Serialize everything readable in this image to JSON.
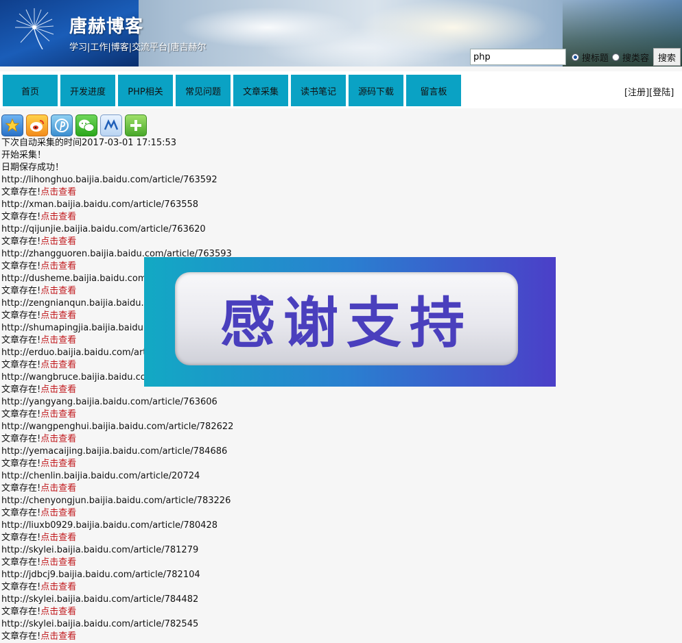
{
  "header": {
    "title": "唐赫博客",
    "subtitle": "学习|工作|博客|交流平台|唐吉赫尔",
    "search_value": "php",
    "radio_title_label": "搜标题",
    "radio_content_label": "搜类容",
    "search_button": "搜索"
  },
  "nav": {
    "items": [
      "首页",
      "开发进度",
      "PHP相关",
      "常见问题",
      "文章采集",
      "读书笔记",
      "源码下载",
      "留言板"
    ],
    "auth": "[注册][登陆]"
  },
  "share_icons": [
    "favorite-star-icon",
    "weibo-icon",
    "pinterest-icon",
    "wechat-icon",
    "renren-icon",
    "plus-icon"
  ],
  "log": {
    "next_time": "下次自动采集的时间2017-03-01 17:15:53",
    "start": "开始采集！",
    "date_saved": "日期保存成功！",
    "exists_prefix": "文章存在!",
    "view_link": "点击查看",
    "urls": [
      "http://lihonghuo.baijia.baidu.com/article/763592",
      "http://xman.baijia.baidu.com/article/763558",
      "http://qijunjie.baijia.baidu.com/article/763620",
      "http://zhangguoren.baijia.baidu.com/article/763593",
      "http://dusheme.baijia.baidu.com/",
      "http://zengnianqun.baijia.baidu.co",
      "http://shumapingjia.baijia.baidu.c",
      "http://erduo.baijia.baidu.com/arti",
      "http://wangbruce.baijia.baidu.com",
      "http://yangyang.baijia.baidu.com/article/763606",
      "http://wangpenghui.baijia.baidu.com/article/782622",
      "http://yemacaijing.baijia.baidu.com/article/784686",
      "http://chenlin.baijia.baidu.com/article/20724",
      "http://chenyongjun.baijia.baidu.com/article/783226",
      "http://liuxb0929.baijia.baidu.com/article/780428",
      "http://skylei.baijia.baidu.com/article/781279",
      "http://jdbcj9.baijia.baidu.com/article/782104",
      "http://skylei.baijia.baidu.com/article/784482",
      "http://skylei.baijia.baidu.com/article/782545"
    ]
  },
  "overlay": {
    "text": "感谢支持"
  },
  "colors": {
    "nav_bg": "#0aa2c4",
    "link_red": "#c0171b",
    "overlay_text": "#4a3fbd"
  }
}
